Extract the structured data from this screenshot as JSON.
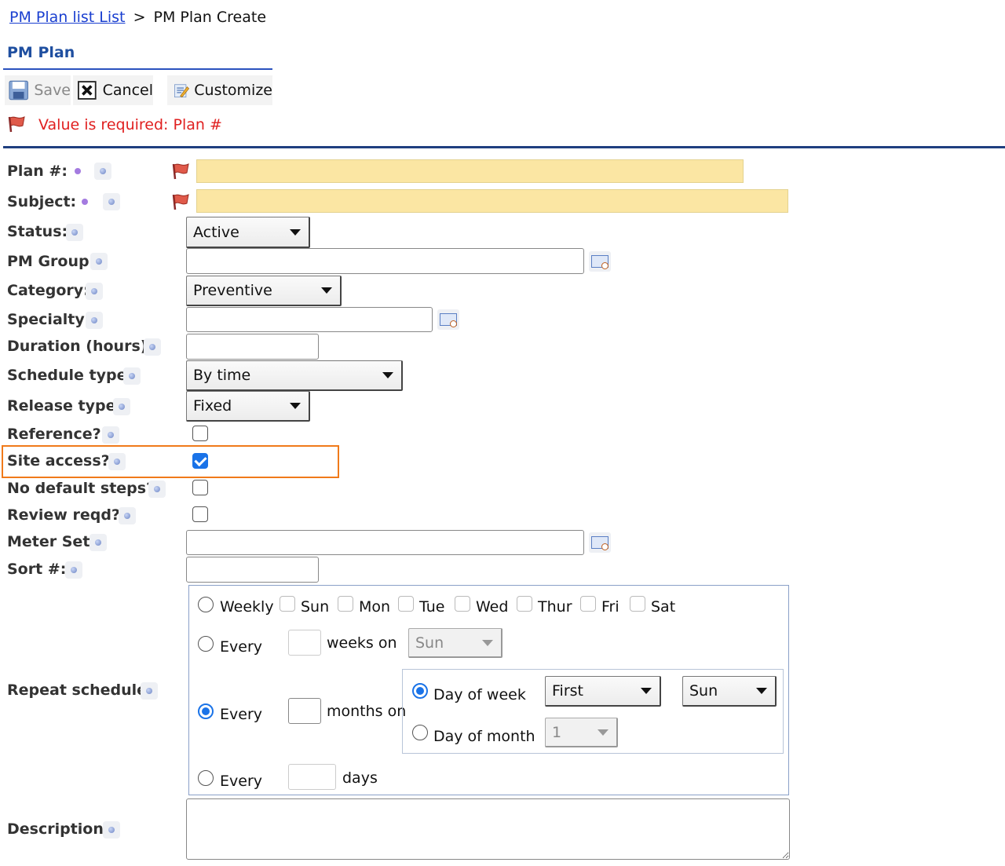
{
  "breadcrumb": {
    "link": "PM Plan list List",
    "separator": ">",
    "current": "PM Plan Create"
  },
  "section_title": "PM Plan",
  "toolbar": {
    "save": "Save",
    "cancel": "Cancel",
    "customize": "Customize"
  },
  "error_message": "Value is required: Plan #",
  "labels": {
    "plan": "Plan #:",
    "subject": "Subject:",
    "status": "Status:",
    "pm_group": "PM Group:",
    "category": "Category:",
    "specialty": "Specialty:",
    "duration": "Duration (hours):",
    "schedule_type": "Schedule type:",
    "release_type": "Release type:",
    "reference": "Reference?:",
    "site_access": "Site access?:",
    "no_default_steps": "No default steps?:",
    "review_reqd": "Review reqd?:",
    "meter_set": "Meter Set:",
    "sort": "Sort #:",
    "repeat_schedule": "Repeat schedule:",
    "description": "Description:"
  },
  "values": {
    "plan": "",
    "subject": "",
    "status": "Active",
    "pm_group": "",
    "category": "Preventive",
    "specialty": "",
    "duration": "",
    "schedule_type": "By time",
    "release_type": "Fixed",
    "reference": false,
    "site_access": true,
    "no_default_steps": false,
    "review_reqd": false,
    "meter_set": "",
    "sort": "",
    "description": ""
  },
  "repeat": {
    "weekly": "Weekly",
    "days": [
      "Sun",
      "Mon",
      "Tue",
      "Wed",
      "Thur",
      "Fri",
      "Sat"
    ],
    "every": "Every",
    "weeks_on": "weeks on",
    "weeks_day_value": "Sun",
    "months_on": "months on",
    "day_of_week": "Day of week",
    "day_of_month": "Day of month",
    "ordinal_value": "First",
    "weekday_value": "Sun",
    "month_day_value": "1",
    "days_label": "days",
    "selected": "months",
    "month_mode": "day_of_week"
  },
  "colors": {
    "link": "#1a3fd0",
    "title": "#1f4fa0",
    "error": "#e02020",
    "highlight": "#f07a1a",
    "required_field": "#fbe6a3",
    "rule": "#1f3f7f"
  }
}
